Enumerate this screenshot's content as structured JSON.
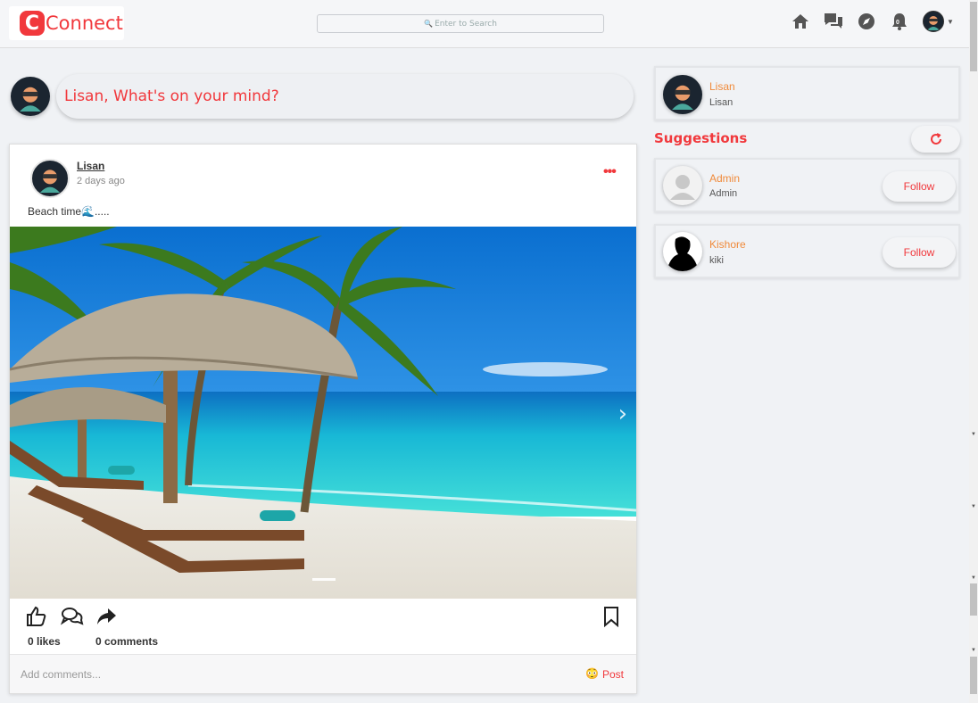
{
  "app": {
    "logo_letter": "C",
    "logo_text": "Connect",
    "brand_color": "#f1383c"
  },
  "search": {
    "placeholder": "Enter to Search"
  },
  "nav": {
    "notifications_count": "0",
    "icons": [
      "home-icon",
      "messages-icon",
      "explore-icon",
      "bell-icon",
      "profile-avatar"
    ]
  },
  "composer": {
    "prompt": "Lisan, What's on your mind?"
  },
  "post": {
    "author": "Lisan",
    "time": "2 days ago",
    "menu": "•••",
    "caption": "Beach time🌊.....",
    "image_alt": "beach",
    "likes": "0 likes",
    "comments": "0 comments",
    "comment_placeholder": "Add comments...",
    "emoji": "😳",
    "post_label": "Post"
  },
  "sidebar": {
    "current_user": {
      "name": "Lisan",
      "username": "Lisan"
    },
    "suggestions_title": "Suggestions",
    "suggestions": [
      {
        "name": "Admin",
        "username": "Admin",
        "button": "Follow"
      },
      {
        "name": "Kishore",
        "username": "kiki",
        "button": "Follow"
      }
    ]
  }
}
